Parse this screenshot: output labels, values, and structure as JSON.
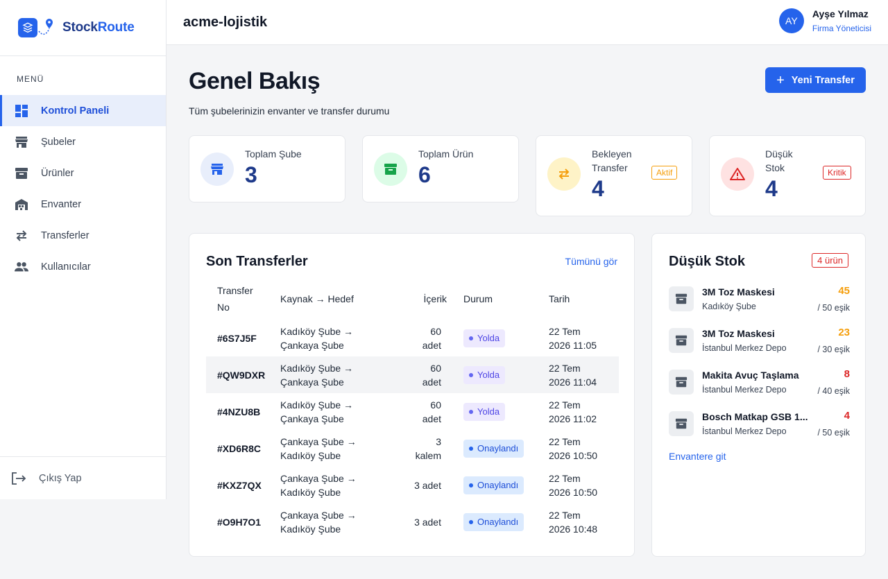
{
  "brand": {
    "name_part1": "Stock",
    "name_part2": "Route",
    "primary_color": "#2563eb"
  },
  "sidebar": {
    "menu_label": "MENÜ",
    "items": [
      {
        "label": "Kontrol Paneli",
        "icon": "dashboard-icon",
        "active": true
      },
      {
        "label": "Şubeler",
        "icon": "store-icon"
      },
      {
        "label": "Ürünler",
        "icon": "archive-box-icon"
      },
      {
        "label": "Envanter",
        "icon": "warehouse-icon"
      },
      {
        "label": "Transferler",
        "icon": "swap-arrows-icon"
      },
      {
        "label": "Kullanıcılar",
        "icon": "users-icon"
      }
    ],
    "logout_label": "Çıkış Yap"
  },
  "header": {
    "org_name": "acme-lojistik",
    "user": {
      "initials": "AY",
      "name": "Ayşe Yılmaz",
      "role": "Firma Yöneticisi"
    }
  },
  "main": {
    "title": "Genel Bakış",
    "subtitle": "Tüm şubelerinizin envanter ve transfer durumu",
    "new_transfer_label": "Yeni Transfer"
  },
  "stats": [
    {
      "label": "Toplam Şube",
      "value": "3",
      "icon": "store-icon"
    },
    {
      "label": "Toplam Ürün",
      "value": "6",
      "icon": "archive-box-icon"
    },
    {
      "label_line1": "Bekleyen",
      "label_line2": "Transfer",
      "value": "4",
      "badge": "Aktif",
      "icon": "swap-arrows-icon"
    },
    {
      "label_line1": "Düşük",
      "label_line2": "Stok",
      "value": "4",
      "badge": "Kritik",
      "icon": "warning-icon"
    }
  ],
  "transfers": {
    "title": "Son Transferler",
    "view_all": "Tümünü gör",
    "columns": {
      "no_line1": "Transfer",
      "no_line2": "No",
      "route": "Kaynak → Hedef",
      "content": "İçerik",
      "status": "Durum",
      "date": "Tarih"
    },
    "rows": [
      {
        "no": "#6S7J5F",
        "from": "Kadıköy Şube →",
        "to": "Çankaya Şube",
        "qty1": "60",
        "qty2": "adet",
        "status": "Yolda",
        "date1": "22 Tem",
        "date2": "2026 11:05"
      },
      {
        "no": "#QW9DXR",
        "from": "Kadıköy Şube →",
        "to": "Çankaya Şube",
        "qty1": "60",
        "qty2": "adet",
        "status": "Yolda",
        "date1": "22 Tem",
        "date2": "2026 11:04"
      },
      {
        "no": "#4NZU8B",
        "from": "Kadıköy Şube →",
        "to": "Çankaya Şube",
        "qty1": "60",
        "qty2": "adet",
        "status": "Yolda",
        "date1": "22 Tem",
        "date2": "2026 11:02"
      },
      {
        "no": "#XD6R8C",
        "from": "Çankaya Şube →",
        "to": "Kadıköy Şube",
        "qty1": "3",
        "qty2": "kalem",
        "status": "Onaylandı",
        "date1": "22 Tem",
        "date2": "2026 10:50"
      },
      {
        "no": "#KXZ7QX",
        "from": "Çankaya Şube →",
        "to": "Kadıköy Şube",
        "qty1": "3 adet",
        "qty2": "",
        "status": "Onaylandı",
        "date1": "22 Tem",
        "date2": "2026 10:50"
      },
      {
        "no": "#O9H7O1",
        "from": "Çankaya Şube →",
        "to": "Kadıköy Şube",
        "qty1": "3 adet",
        "qty2": "",
        "status": "Onaylandı",
        "date1": "22 Tem",
        "date2": "2026 10:48"
      }
    ]
  },
  "low_stock": {
    "title": "Düşük Stok",
    "badge": "4 ürün",
    "items": [
      {
        "name": "3M Toz Maskesi",
        "location": "Kadıköy Şube",
        "qty": "45",
        "threshold": "/ 50 eşik",
        "color": "#f59e0b"
      },
      {
        "name": "3M Toz Maskesi",
        "location": "İstanbul Merkez Depo",
        "qty": "23",
        "threshold": "/ 30 eşik",
        "color": "#f59e0b"
      },
      {
        "name": "Makita Avuç Taşlama",
        "location": "İstanbul Merkez Depo",
        "qty": "8",
        "threshold": "/ 40 eşik",
        "color": "#dc2626"
      },
      {
        "name": "Bosch Matkap GSB 1...",
        "location": "İstanbul Merkez Depo",
        "qty": "4",
        "threshold": "/ 50 eşik",
        "color": "#dc2626"
      }
    ],
    "link": "Envantere git"
  }
}
